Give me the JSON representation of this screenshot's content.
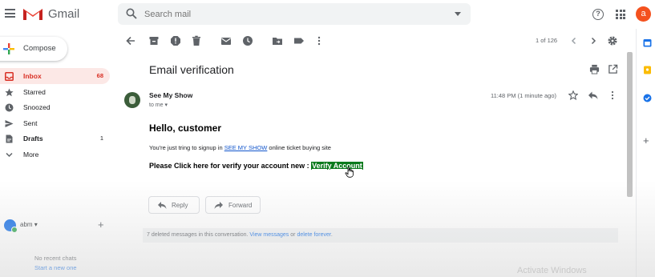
{
  "app": {
    "name": "Gmail"
  },
  "search": {
    "placeholder": "Search mail"
  },
  "account": {
    "avatar_letter": "a",
    "avatar_color": "#f4511e"
  },
  "compose": {
    "label": "Compose"
  },
  "sidebar": {
    "items": [
      {
        "label": "Inbox",
        "count": "68",
        "icon": "inbox-icon",
        "active": true
      },
      {
        "label": "Starred",
        "count": "",
        "icon": "star-icon"
      },
      {
        "label": "Snoozed",
        "count": "",
        "icon": "clock-icon"
      },
      {
        "label": "Sent",
        "count": "",
        "icon": "send-icon"
      },
      {
        "label": "Drafts",
        "count": "1",
        "icon": "draft-icon"
      },
      {
        "label": "More",
        "count": "",
        "icon": "chevron-down-icon"
      }
    ]
  },
  "hangouts": {
    "user": "abm",
    "no_chats": "No recent chats",
    "start_chat": "Start a new one"
  },
  "toolbar": {
    "pager": "1 of 126"
  },
  "message": {
    "subject": "Email verification",
    "sender": "See My Show",
    "to": "to me",
    "time": "11:48 PM (1 minute ago)",
    "greeting": "Hello, customer",
    "line1_prefix": "You're just tring to signup in ",
    "line1_link": "SEE MY SHOW",
    "line1_suffix": " online ticket buying site",
    "line2_prefix": "Please Click here for verify your account new : ",
    "line2_link": "Verify Account",
    "link_highlight_color": "#0b7a1d"
  },
  "actions": {
    "reply": "Reply",
    "forward": "Forward"
  },
  "deleted_notice": {
    "prefix": "7 deleted messages in this conversation. ",
    "view_link": "View messages",
    "middle": " or ",
    "delete_link": "delete forever",
    "suffix": "."
  },
  "watermark": "Activate Windows",
  "colors": {
    "gmail_red": "#d93025",
    "link_blue": "#1a73e8",
    "inbox_bg": "#fce8e6"
  }
}
